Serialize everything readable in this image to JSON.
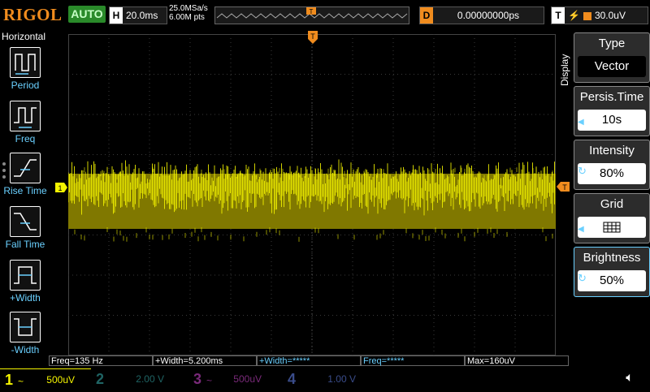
{
  "top": {
    "brand": "RIGOL",
    "run_state": "AUTO",
    "horizontal_label": "H",
    "timebase": "20.0ms",
    "sample_rate": "25.0MSa/s",
    "mem_depth": "6.00M pts",
    "trigger_marker": "T",
    "delay_label": "D",
    "delay": "0.00000000ps",
    "trigger_label": "T",
    "trigger_level": "30.0uV"
  },
  "sidebar": {
    "title": "Horizontal",
    "items": [
      {
        "label": "Period",
        "icon": "period-icon"
      },
      {
        "label": "Freq",
        "icon": "freq-icon"
      },
      {
        "label": "Rise Time",
        "icon": "rise-time-icon"
      },
      {
        "label": "Fall Time",
        "icon": "fall-time-icon"
      },
      {
        "label": "+Width",
        "icon": "pos-width-icon"
      },
      {
        "label": "-Width",
        "icon": "neg-width-icon"
      }
    ]
  },
  "display_menu": {
    "tab": "Display",
    "items": [
      {
        "label": "Type",
        "value": "Vector"
      },
      {
        "label": "Persis.Time",
        "value": "10s"
      },
      {
        "label": "Intensity",
        "value": "80%"
      },
      {
        "label": "Grid",
        "value": ""
      },
      {
        "label": "Brightness",
        "value": "50%"
      }
    ]
  },
  "measurements": [
    {
      "text": "Freq=135 Hz"
    },
    {
      "text": "+Width=5.200ms"
    },
    {
      "text": "+Width=*****"
    },
    {
      "text": "Freq=*****"
    },
    {
      "text": "Max=160uV"
    }
  ],
  "channels": [
    {
      "num": "1",
      "coupling": "~",
      "scale": "500uV",
      "color": "#f4f400",
      "active": true
    },
    {
      "num": "2",
      "scale": "2.00 V",
      "color": "#00e0e0",
      "active": false
    },
    {
      "num": "3",
      "coupling": "~",
      "scale": "500uV",
      "color": "#e000e0",
      "active": false
    },
    {
      "num": "4",
      "scale": "1.00 V",
      "color": "#2a6cff",
      "active": false
    }
  ],
  "waveform": {
    "channel_marker": "1",
    "color": "#f4f400"
  },
  "colors": {
    "accent": "#f08c1e",
    "menu_value": "#6ad0ff"
  }
}
